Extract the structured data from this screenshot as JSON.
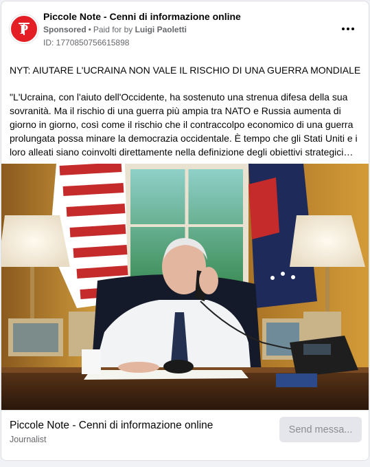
{
  "post": {
    "page_name": "Piccole Note - Cenni di informazione online",
    "sponsored": "Sponsored",
    "separator": "•",
    "paid_for_prefix": "Paid for by",
    "payer": "Luigi Paoletti",
    "ad_id": "ID: 1770850756615898",
    "more_icon": "more-horizontal-icon",
    "headline": "NYT: AIUTARE L'UCRAINA NON VALE IL RISCHIO DI UNA GUERRA MONDIALE",
    "body_lines": [
      "\"L'Ucraina, con l'aiuto dell'Occidente, ha sostenuto una strenua difesa della sua",
      "sovranità. Ma il rischio di una guerra più ampia tra NATO e Russia aumenta di",
      "giorno in giorno, così come il rischio che il contraccolpo economico di una guerra",
      "prolungata possa minare la democrazia occidentale. È tempo che gli Stati Uniti e i",
      "loro alleati siano coinvolti direttamente nella definizione degli obiettivi strategici…"
    ],
    "avatar_logo_text": "PN"
  },
  "footer": {
    "title": "Piccole Note - Cenni di informazione online",
    "subtitle": "Journalist",
    "cta_label": "Send messa..."
  },
  "colors": {
    "brand_red": "#e31e24",
    "secondary_text": "#65676b",
    "button_bg": "#e4e6eb",
    "button_text": "#8a8d91"
  }
}
